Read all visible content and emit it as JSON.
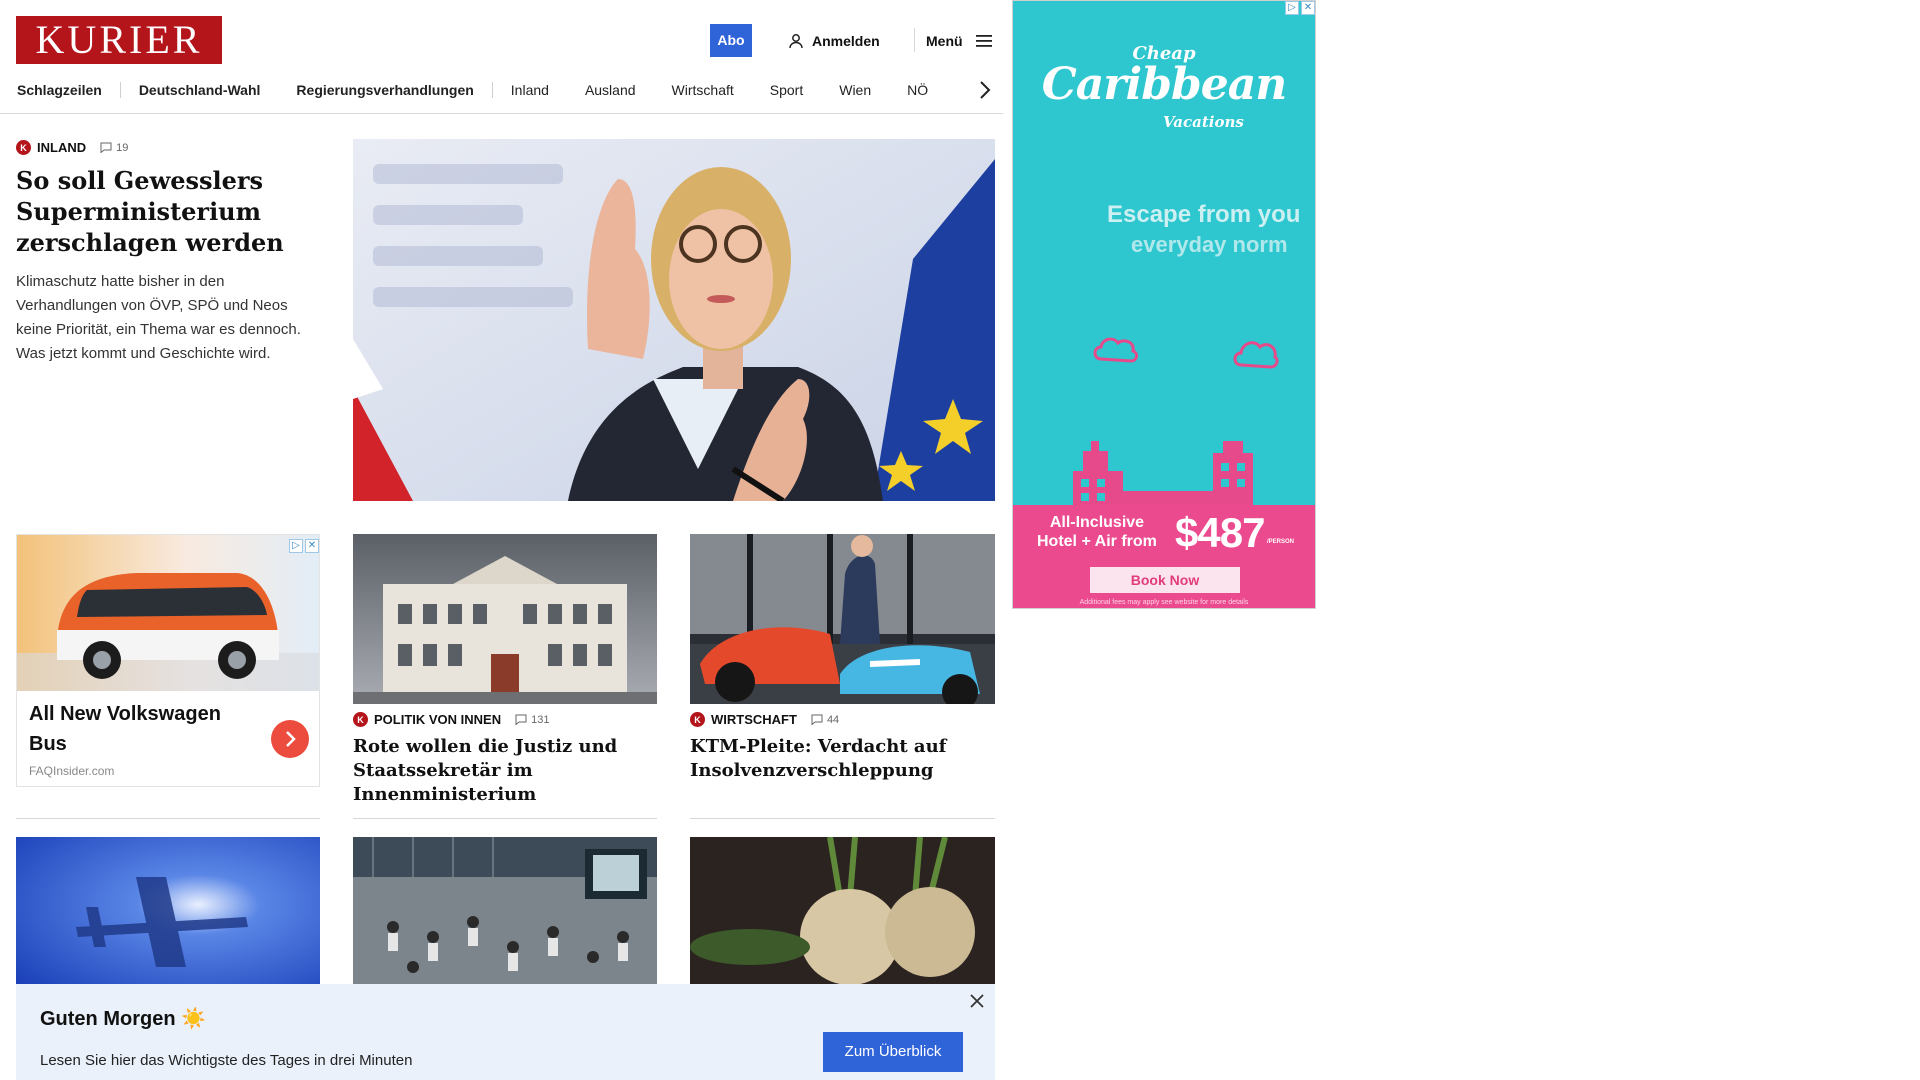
{
  "header": {
    "logo": "KURIER",
    "abo_label": "Abo",
    "login_label": "Anmelden",
    "menu_label": "Menü"
  },
  "nav": {
    "items": [
      "Schlagzeilen",
      "Deutschland-Wahl",
      "Regierungsverhandlungen",
      "Inland",
      "Ausland",
      "Wirtschaft",
      "Sport",
      "Wien",
      "NÖ"
    ]
  },
  "lead": {
    "badge": "K",
    "category": "INLAND",
    "comments": "19",
    "title": "So soll Gewesslers Superministerium zerschlagen werden",
    "teaser": "Klimaschutz hatte bisher in den Verhandlungen von ÖVP, SPÖ und Neos keine Priorität, ein Thema war es dennoch. Was jetzt kommt und Geschichte wird."
  },
  "ad_tile": {
    "title": "All New Volkswagen Bus",
    "source": "FAQInsider.com"
  },
  "stories": [
    {
      "badge": "K",
      "category": "POLITIK VON INNEN",
      "comments": "131",
      "title": "Rote wollen die Justiz und Staatssekretär im Innenministerium"
    },
    {
      "badge": "K",
      "category": "WIRTSCHAFT",
      "comments": "44",
      "title": "KTM-Pleite: Verdacht auf Insolvenzverschleppung"
    }
  ],
  "sky_ad": {
    "logo_top": "Cheap",
    "logo_main": "Caribbean",
    "logo_bottom": "Vacations",
    "escape_line1": "Escape  from  you",
    "escape_line2": "everyday  norm",
    "allinc_line1": "All-Inclusive",
    "allinc_line2": "Hotel + Air from",
    "price": "$487",
    "per_person": "/PERSON",
    "book_label": "Book Now",
    "fine_print": "Additional fees may apply see website for more details"
  },
  "banner": {
    "title": "Guten Morgen ☀️",
    "text": "Lesen Sie hier das Wichtigste des Tages in drei Minuten",
    "button_label": "Zum Überblick"
  },
  "colors": {
    "brand_red": "#b3151b",
    "accent_blue": "#2f63d8",
    "ad_teal": "#2ec6cf",
    "ad_pink": "#ec4a8e",
    "banner_bg": "#eaf1fb"
  }
}
